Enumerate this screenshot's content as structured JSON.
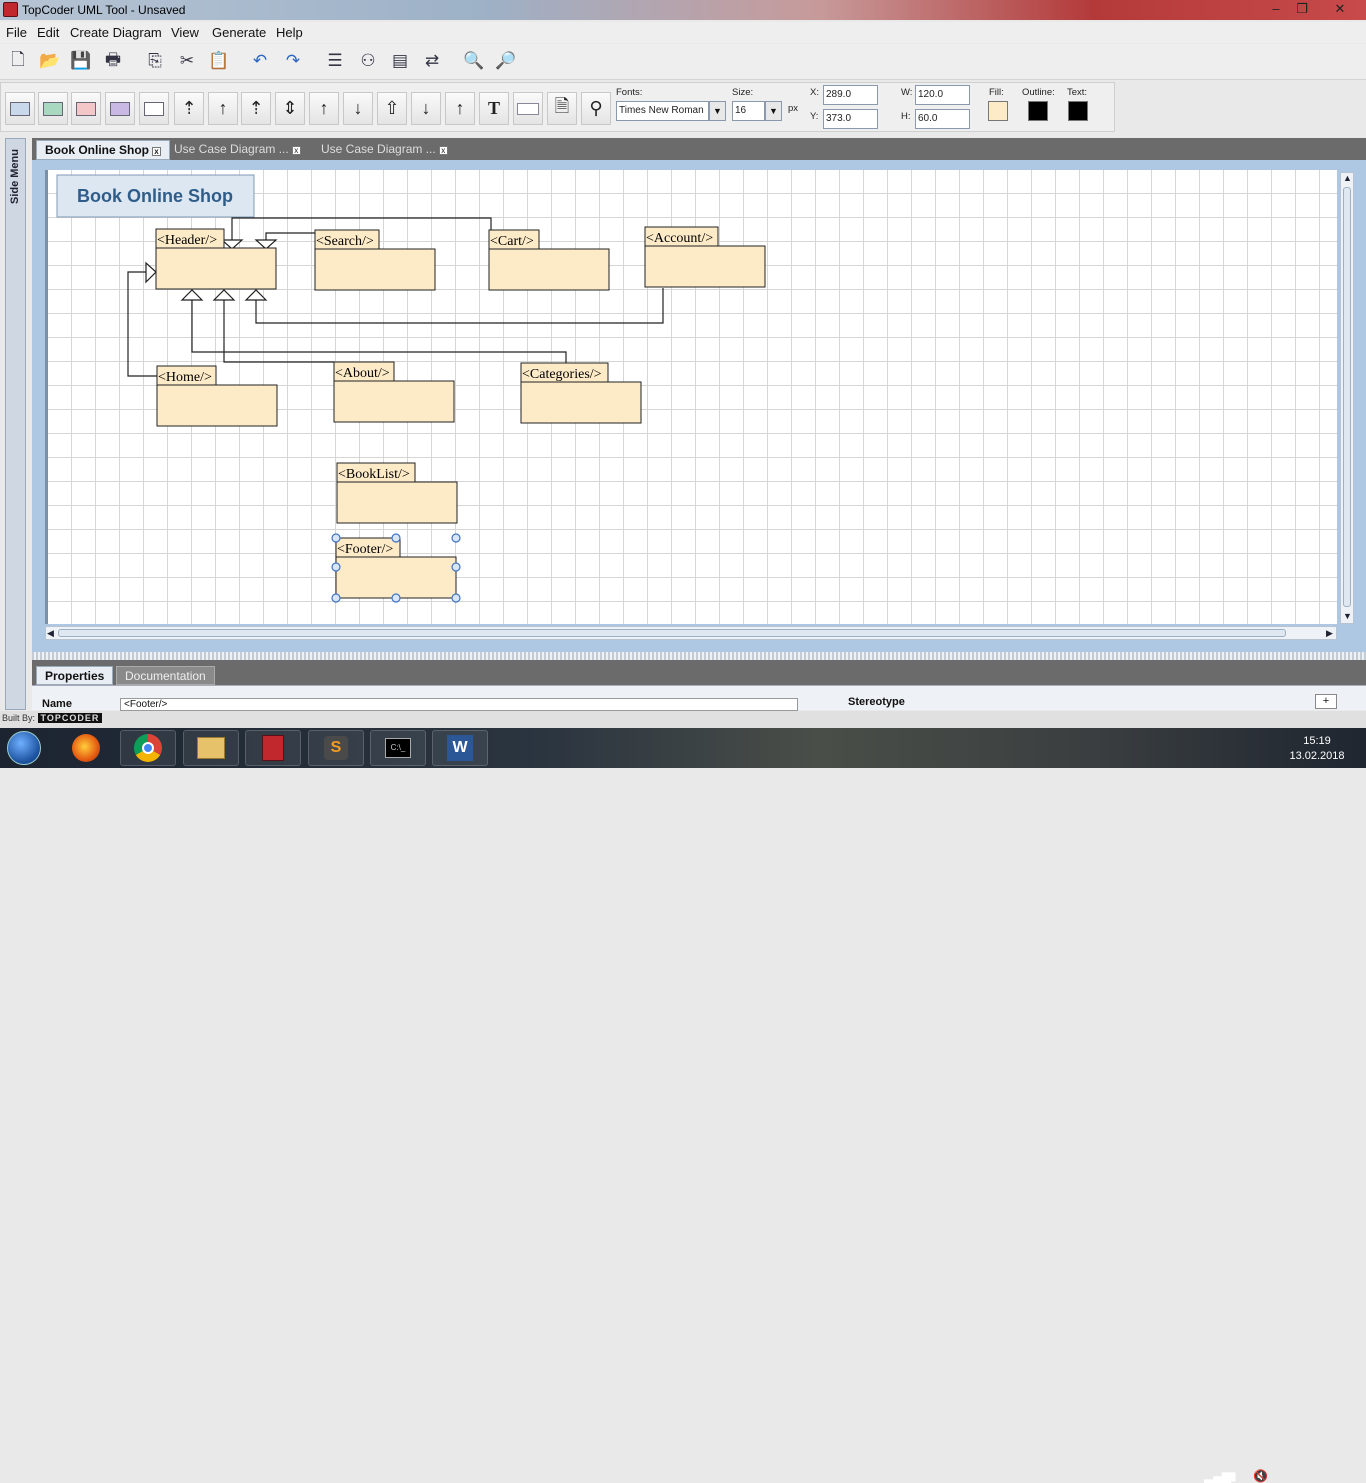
{
  "window": {
    "title": "TopCoder UML Tool - Unsaved",
    "minimize": "–",
    "maximize": "❐",
    "close": "✕"
  },
  "menu": [
    {
      "label": "File"
    },
    {
      "label": "Edit"
    },
    {
      "label": "Create Diagram"
    },
    {
      "label": "View"
    },
    {
      "label": "Generate"
    },
    {
      "label": "Help"
    }
  ],
  "toolbar_icons": [
    "new-file-icon",
    "open-folder-icon",
    "save-icon",
    "print-icon",
    "copy-icon",
    "cut-icon",
    "paste-icon",
    "undo-icon",
    "redo-icon",
    "align-icon",
    "distribute-icon",
    "arrange-icon",
    "layout-icon",
    "zoom-in-icon",
    "zoom-out-icon"
  ],
  "format": {
    "fonts_label": "Fonts:",
    "font_value": "Times New Roman",
    "size_label": "Size:",
    "size_value": "16",
    "px_label": "px",
    "x_label": "X:",
    "x_value": "289.0",
    "y_label": "Y:",
    "y_value": "373.0",
    "w_label": "W:",
    "w_value": "120.0",
    "h_label": "H:",
    "h_value": "60.0",
    "fill_label": "Fill:",
    "fill_color": "#fdebc8",
    "outline_label": "Outline:",
    "outline_color": "#000000",
    "text_label": "Text:",
    "text_color": "#000000"
  },
  "sidebar": {
    "label": "Side Menu"
  },
  "tabs": [
    {
      "label": "Book Online Shop"
    },
    {
      "label": "Use Case Diagram ..."
    },
    {
      "label": "Use Case Diagram ..."
    }
  ],
  "diagram": {
    "title": "Book Online Shop",
    "packages": [
      {
        "name": "<Header/>"
      },
      {
        "name": "<Search/>"
      },
      {
        "name": "<Cart/>"
      },
      {
        "name": "<Account/>"
      },
      {
        "name": "<Home/>"
      },
      {
        "name": "<About/>"
      },
      {
        "name": "<Categories/>"
      },
      {
        "name": "<BookList/>"
      },
      {
        "name": "<Footer/>"
      }
    ],
    "colors": {
      "package_fill": "#fdebc8",
      "title_fill": "#dde7f2",
      "title_text": "#2f5d8a",
      "selection": "#3f73c4"
    }
  },
  "bottom_tabs": [
    {
      "label": "Properties"
    },
    {
      "label": "Documentation"
    }
  ],
  "properties": {
    "name_label": "Name",
    "name_value": "<Footer/>",
    "stereotype_label": "Stereotype"
  },
  "built_by": {
    "label": "Built By:",
    "brand": "TOPCODER"
  },
  "taskbar": {
    "apps": [
      "start-orb",
      "firefox",
      "chrome",
      "explorer",
      "topcoder-uml",
      "sublime",
      "cmd",
      "word"
    ],
    "time": "15:19",
    "date": "13.02.2018"
  }
}
